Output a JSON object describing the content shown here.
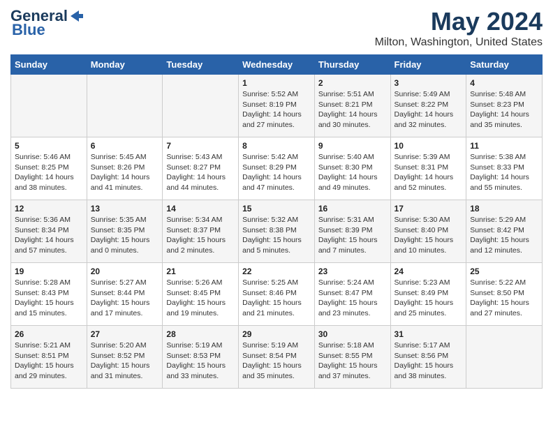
{
  "header": {
    "logo_line1": "General",
    "logo_line2": "Blue",
    "title": "May 2024",
    "subtitle": "Milton, Washington, United States"
  },
  "weekdays": [
    "Sunday",
    "Monday",
    "Tuesday",
    "Wednesday",
    "Thursday",
    "Friday",
    "Saturday"
  ],
  "weeks": [
    [
      {
        "day": "",
        "info": ""
      },
      {
        "day": "",
        "info": ""
      },
      {
        "day": "",
        "info": ""
      },
      {
        "day": "1",
        "info": "Sunrise: 5:52 AM\nSunset: 8:19 PM\nDaylight: 14 hours\nand 27 minutes."
      },
      {
        "day": "2",
        "info": "Sunrise: 5:51 AM\nSunset: 8:21 PM\nDaylight: 14 hours\nand 30 minutes."
      },
      {
        "day": "3",
        "info": "Sunrise: 5:49 AM\nSunset: 8:22 PM\nDaylight: 14 hours\nand 32 minutes."
      },
      {
        "day": "4",
        "info": "Sunrise: 5:48 AM\nSunset: 8:23 PM\nDaylight: 14 hours\nand 35 minutes."
      }
    ],
    [
      {
        "day": "5",
        "info": "Sunrise: 5:46 AM\nSunset: 8:25 PM\nDaylight: 14 hours\nand 38 minutes."
      },
      {
        "day": "6",
        "info": "Sunrise: 5:45 AM\nSunset: 8:26 PM\nDaylight: 14 hours\nand 41 minutes."
      },
      {
        "day": "7",
        "info": "Sunrise: 5:43 AM\nSunset: 8:27 PM\nDaylight: 14 hours\nand 44 minutes."
      },
      {
        "day": "8",
        "info": "Sunrise: 5:42 AM\nSunset: 8:29 PM\nDaylight: 14 hours\nand 47 minutes."
      },
      {
        "day": "9",
        "info": "Sunrise: 5:40 AM\nSunset: 8:30 PM\nDaylight: 14 hours\nand 49 minutes."
      },
      {
        "day": "10",
        "info": "Sunrise: 5:39 AM\nSunset: 8:31 PM\nDaylight: 14 hours\nand 52 minutes."
      },
      {
        "day": "11",
        "info": "Sunrise: 5:38 AM\nSunset: 8:33 PM\nDaylight: 14 hours\nand 55 minutes."
      }
    ],
    [
      {
        "day": "12",
        "info": "Sunrise: 5:36 AM\nSunset: 8:34 PM\nDaylight: 14 hours\nand 57 minutes."
      },
      {
        "day": "13",
        "info": "Sunrise: 5:35 AM\nSunset: 8:35 PM\nDaylight: 15 hours\nand 0 minutes."
      },
      {
        "day": "14",
        "info": "Sunrise: 5:34 AM\nSunset: 8:37 PM\nDaylight: 15 hours\nand 2 minutes."
      },
      {
        "day": "15",
        "info": "Sunrise: 5:32 AM\nSunset: 8:38 PM\nDaylight: 15 hours\nand 5 minutes."
      },
      {
        "day": "16",
        "info": "Sunrise: 5:31 AM\nSunset: 8:39 PM\nDaylight: 15 hours\nand 7 minutes."
      },
      {
        "day": "17",
        "info": "Sunrise: 5:30 AM\nSunset: 8:40 PM\nDaylight: 15 hours\nand 10 minutes."
      },
      {
        "day": "18",
        "info": "Sunrise: 5:29 AM\nSunset: 8:42 PM\nDaylight: 15 hours\nand 12 minutes."
      }
    ],
    [
      {
        "day": "19",
        "info": "Sunrise: 5:28 AM\nSunset: 8:43 PM\nDaylight: 15 hours\nand 15 minutes."
      },
      {
        "day": "20",
        "info": "Sunrise: 5:27 AM\nSunset: 8:44 PM\nDaylight: 15 hours\nand 17 minutes."
      },
      {
        "day": "21",
        "info": "Sunrise: 5:26 AM\nSunset: 8:45 PM\nDaylight: 15 hours\nand 19 minutes."
      },
      {
        "day": "22",
        "info": "Sunrise: 5:25 AM\nSunset: 8:46 PM\nDaylight: 15 hours\nand 21 minutes."
      },
      {
        "day": "23",
        "info": "Sunrise: 5:24 AM\nSunset: 8:47 PM\nDaylight: 15 hours\nand 23 minutes."
      },
      {
        "day": "24",
        "info": "Sunrise: 5:23 AM\nSunset: 8:49 PM\nDaylight: 15 hours\nand 25 minutes."
      },
      {
        "day": "25",
        "info": "Sunrise: 5:22 AM\nSunset: 8:50 PM\nDaylight: 15 hours\nand 27 minutes."
      }
    ],
    [
      {
        "day": "26",
        "info": "Sunrise: 5:21 AM\nSunset: 8:51 PM\nDaylight: 15 hours\nand 29 minutes."
      },
      {
        "day": "27",
        "info": "Sunrise: 5:20 AM\nSunset: 8:52 PM\nDaylight: 15 hours\nand 31 minutes."
      },
      {
        "day": "28",
        "info": "Sunrise: 5:19 AM\nSunset: 8:53 PM\nDaylight: 15 hours\nand 33 minutes."
      },
      {
        "day": "29",
        "info": "Sunrise: 5:19 AM\nSunset: 8:54 PM\nDaylight: 15 hours\nand 35 minutes."
      },
      {
        "day": "30",
        "info": "Sunrise: 5:18 AM\nSunset: 8:55 PM\nDaylight: 15 hours\nand 37 minutes."
      },
      {
        "day": "31",
        "info": "Sunrise: 5:17 AM\nSunset: 8:56 PM\nDaylight: 15 hours\nand 38 minutes."
      },
      {
        "day": "",
        "info": ""
      }
    ]
  ]
}
